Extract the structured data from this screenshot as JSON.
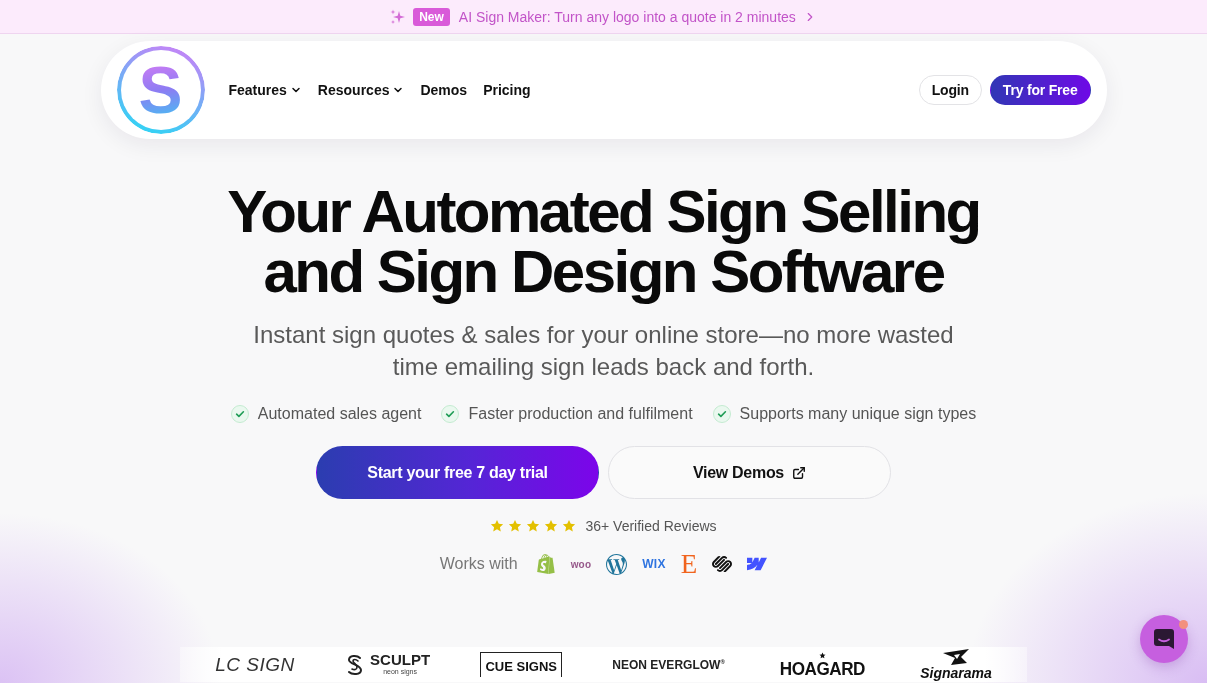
{
  "announcement": {
    "badge": "New",
    "text": "AI Sign Maker: Turn any logo into a quote in 2 minutes"
  },
  "logo": {
    "letter": "S"
  },
  "nav": {
    "links": [
      {
        "label": "Features",
        "dropdown": true
      },
      {
        "label": "Resources",
        "dropdown": true
      },
      {
        "label": "Demos",
        "dropdown": false
      },
      {
        "label": "Pricing",
        "dropdown": false
      }
    ],
    "buttons": [
      {
        "label": "Login",
        "kind": "outline"
      },
      {
        "label": "Try for Free",
        "kind": "primary"
      }
    ]
  },
  "hero": {
    "title": "Your Automated Sign Selling and Sign Design Software",
    "subtitle": "Instant sign quotes & sales for your online store—no more wasted time emailing sign leads back and forth.",
    "features": [
      "Automated sales agent",
      "Faster production and fulfilment",
      "Supports many unique sign types"
    ],
    "actions": [
      {
        "label": "Start your free 7 day trial",
        "kind": "primary",
        "external": false
      },
      {
        "label": "View Demos",
        "kind": "outline",
        "external": true
      }
    ],
    "reviews": {
      "stars": 5,
      "text": "36+ Verified Reviews"
    },
    "works_with": {
      "label": "Works with",
      "platforms": [
        {
          "kind": "shopify"
        },
        {
          "kind": "woo",
          "text": "woo"
        },
        {
          "kind": "wordpress"
        },
        {
          "kind": "wix",
          "text": "WIX"
        },
        {
          "kind": "etsy",
          "text": "E"
        },
        {
          "kind": "squarespace"
        },
        {
          "kind": "webflow"
        }
      ]
    }
  },
  "customer_logos": [
    {
      "kind": "lc",
      "text": "LC SIGN"
    },
    {
      "kind": "sculpt",
      "text": "SCULPT",
      "subtext": "neon signs"
    },
    {
      "kind": "cue",
      "text": "CUE SIGNS"
    },
    {
      "kind": "everglow",
      "text": "NEON EVERGLOW$^{®}$"
    },
    {
      "kind": "hoagard",
      "text": "HOAGARD"
    },
    {
      "kind": "signarama",
      "text": "Signarama"
    }
  ]
}
